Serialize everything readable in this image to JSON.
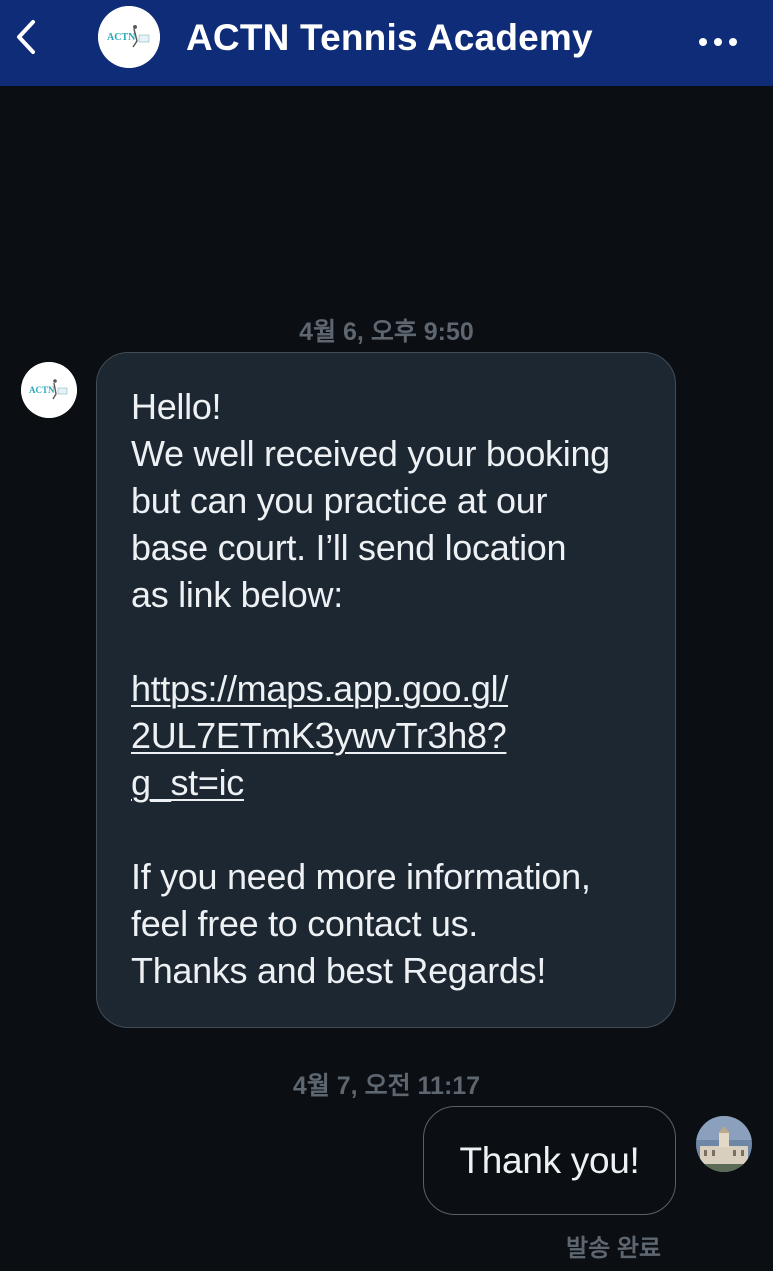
{
  "header": {
    "back_icon": "chevron-left-icon",
    "title": "ACTN Tennis Academy",
    "avatar_logo_text": "ACTN",
    "more_icon": "more-horizontal-icon"
  },
  "messages": [
    {
      "timestamp": "4월 6, 오후 9:50",
      "direction": "incoming",
      "avatar_logo_text": "ACTN",
      "lines": [
        "Hello!",
        "We well received your booking",
        "but can you practice at our",
        "base court. I’ll send location",
        "as link below:",
        "",
        "https://maps.app.goo.gl/",
        "2UL7ETmK3ywvTr3h8?",
        "g_st=ic",
        "",
        "If you need more information,",
        "feel free to contact us.",
        "Thanks and best Regards!"
      ]
    },
    {
      "timestamp": "4월 7, 오전 11:17",
      "direction": "outgoing",
      "text": "Thank you!",
      "status": "발송 완료"
    }
  ],
  "colors": {
    "header_bg": "#0f2c78",
    "screen_bg": "#0b0e13",
    "incoming_bubble_bg": "#1d2731",
    "bubble_text": "#eef1f4",
    "meta_text": "#5e6670"
  }
}
